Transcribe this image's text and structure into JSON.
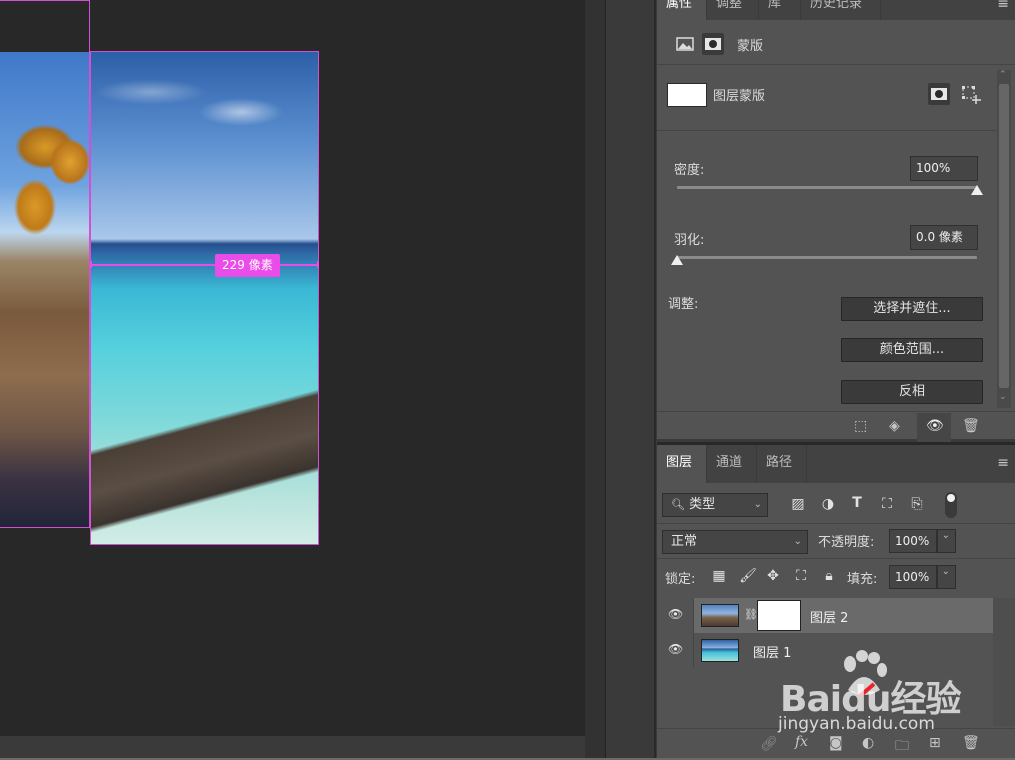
{
  "canvas": {
    "measure_label": "229 像素"
  },
  "properties_panel": {
    "tabs": [
      "属性",
      "调整",
      "库",
      "历史记录"
    ],
    "active_tab": "属性",
    "mask_type_label": "蒙版",
    "layer_mask_label": "图层蒙版",
    "density_label": "密度:",
    "density_value": "100%",
    "density_level": 1.0,
    "feather_label": "羽化:",
    "feather_value": "0.0 像素",
    "feather_level": 0.0,
    "refine_label": "调整:",
    "buttons": {
      "select_and_mask": "选择并遮住...",
      "color_range": "颜色范围...",
      "invert": "反相"
    }
  },
  "layers_panel": {
    "tabs": [
      "图层",
      "通道",
      "路径"
    ],
    "active_tab": "图层",
    "filter_kind": "类型",
    "blend_mode": "正常",
    "opacity_label": "不透明度:",
    "opacity_value": "100%",
    "lock_label": "锁定:",
    "fill_label": "填充:",
    "fill_value": "100%",
    "layers": [
      {
        "name": "图层 2",
        "selected": true,
        "has_mask": true
      },
      {
        "name": "图层 1",
        "selected": false,
        "has_mask": false
      }
    ],
    "footer_fx": "fx"
  },
  "watermark": {
    "logo_text": "Baidu经验",
    "url": "jingyan.baidu.com"
  },
  "colors": {
    "guide_magenta": "#e94ce8",
    "panel_bg": "#535353",
    "canvas_bg": "#282828"
  }
}
